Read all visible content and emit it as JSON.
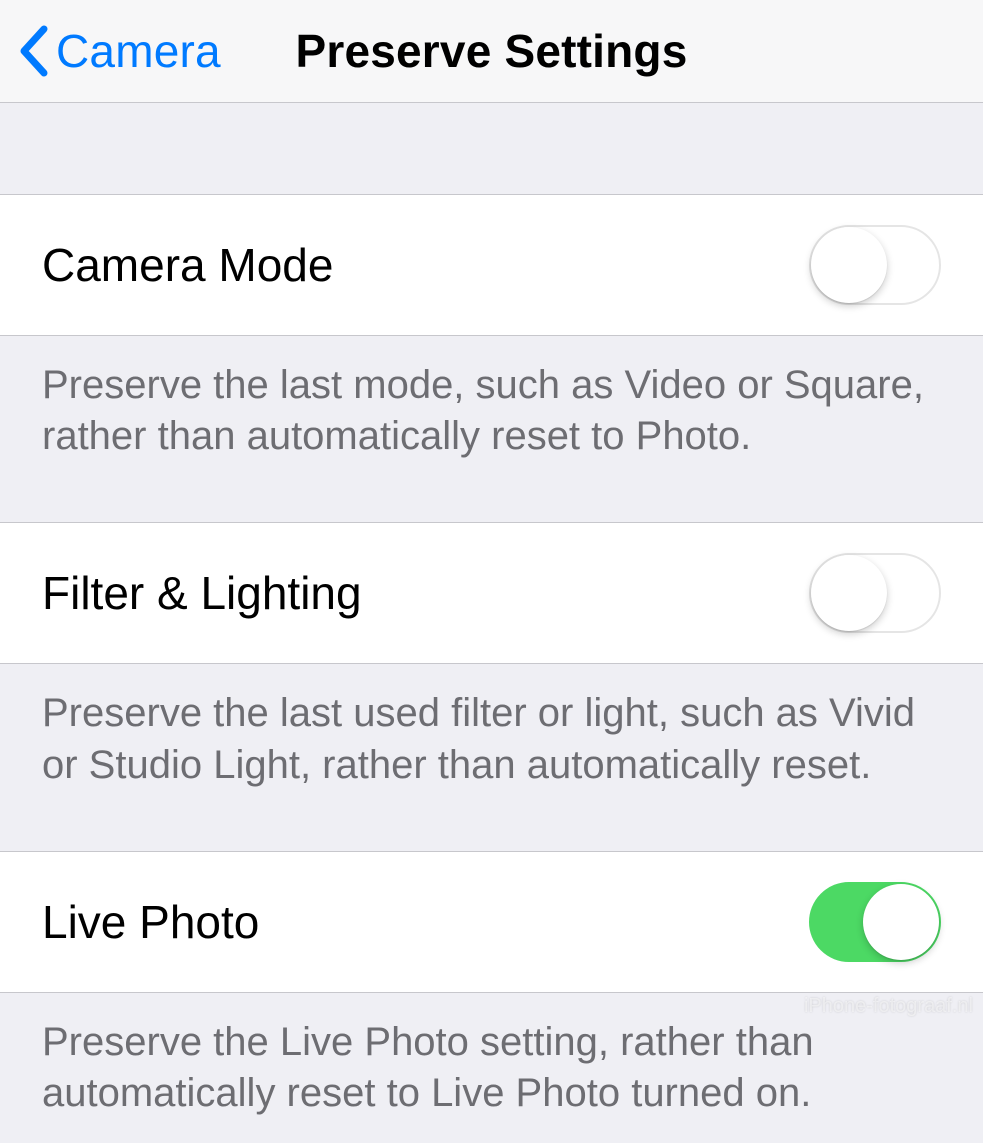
{
  "nav": {
    "back_label": "Camera",
    "title": "Preserve Settings"
  },
  "settings": {
    "camera_mode": {
      "label": "Camera Mode",
      "enabled": false,
      "description": "Preserve the last mode, such as Video or Square, rather than automatically reset to Photo."
    },
    "filter_lighting": {
      "label": "Filter & Lighting",
      "enabled": false,
      "description": "Preserve the last used filter or light, such as Vivid or Studio Light, rather than automatically reset."
    },
    "live_photo": {
      "label": "Live Photo",
      "enabled": true,
      "description": "Preserve the Live Photo setting, rather than automatically reset to Live Photo turned on."
    }
  },
  "watermark": "iPhone-fotograaf.nl"
}
